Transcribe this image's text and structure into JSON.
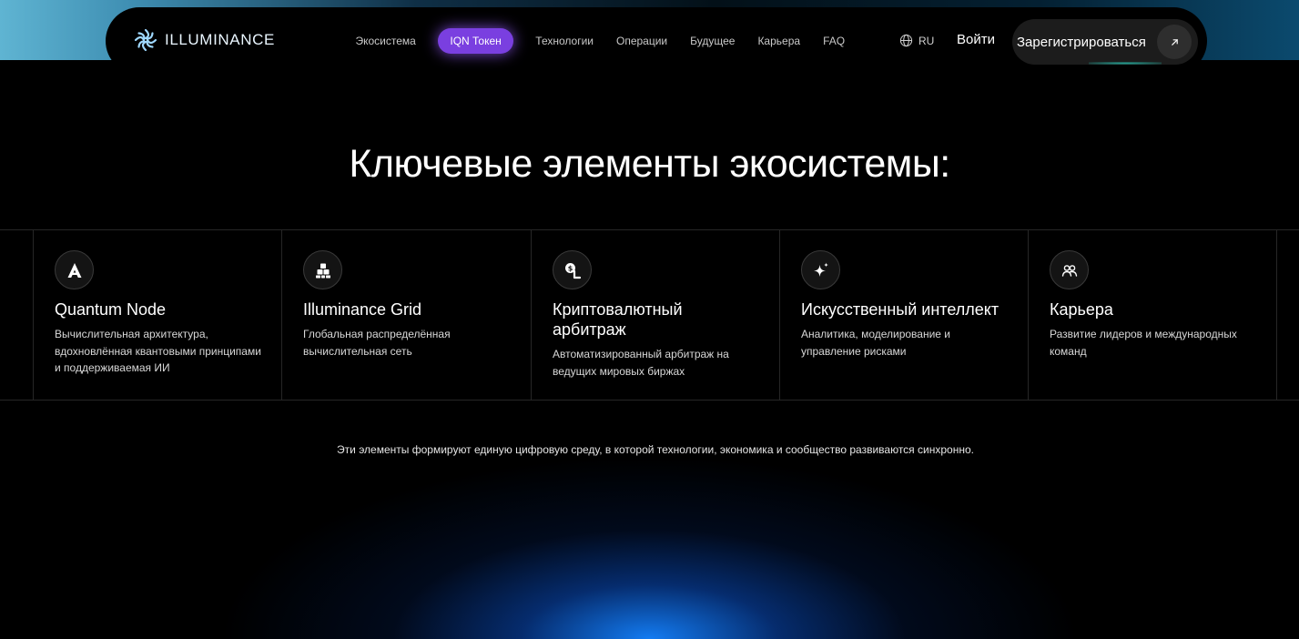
{
  "brand": {
    "name": "ILLUMINANCE"
  },
  "nav": {
    "links": [
      {
        "label": "Экосистема",
        "active": false
      },
      {
        "label": "IQN Токен",
        "active": true
      },
      {
        "label": "Технологии",
        "active": false
      },
      {
        "label": "Операции",
        "active": false
      },
      {
        "label": "Будущее",
        "active": false
      },
      {
        "label": "Карьера",
        "active": false
      },
      {
        "label": "FAQ",
        "active": false
      }
    ],
    "language": "RU",
    "login_label": "Войти",
    "register_label": "Зарегистрироваться",
    "register_icon": "arrow-up-right-icon"
  },
  "section": {
    "title": "Ключевые элементы экосистемы:",
    "cards": [
      {
        "icon": "a-glyph-icon",
        "title": "Quantum Node",
        "description": "Вычислительная архитектура, вдохновлённая квантовыми принципами и поддерживаемая ИИ"
      },
      {
        "icon": "cubes-icon",
        "title": "Illuminance Grid",
        "description": "Глобальная распределённая вычислительная сеть"
      },
      {
        "icon": "coin-exchange-icon",
        "title": "Криптовалютный арбитраж",
        "description": "Автоматизированный арбитраж на ведущих мировых биржах"
      },
      {
        "icon": "sparkle-icon",
        "title": "Искусственный интеллект",
        "description": "Аналитика, моделирование и управление рисками"
      },
      {
        "icon": "team-icon",
        "title": "Карьера",
        "description": "Развитие лидеров и международных команд"
      }
    ],
    "footer_note": "Эти элементы формируют единую цифровую среду, в которой технологии, экономика и сообщество развиваются синхронно."
  },
  "colors": {
    "accent_purple": "#7a3fe0",
    "glow_blue": "#1482ff",
    "background": "#000000"
  }
}
